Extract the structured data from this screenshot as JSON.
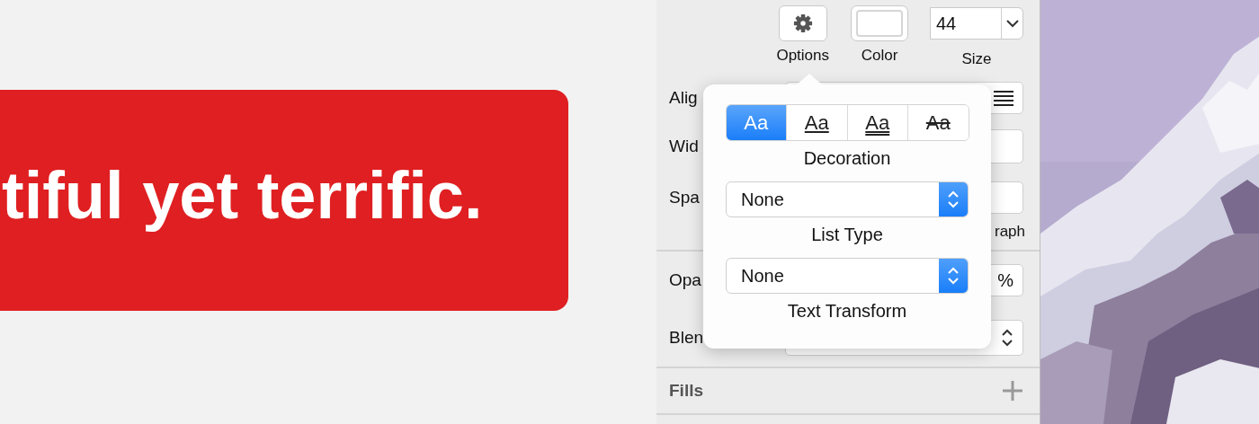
{
  "canvas": {
    "banner_text": "tiful yet terrific."
  },
  "inspector": {
    "text_options": [
      {
        "label": "Options",
        "kind": "gear"
      },
      {
        "label": "Color",
        "kind": "color"
      },
      {
        "label": "Size",
        "kind": "size",
        "value": "44"
      }
    ],
    "rows": [
      {
        "label": "Alig",
        "kind": "alignment"
      },
      {
        "label": "Wid",
        "kind": "width"
      },
      {
        "label": "Spa",
        "kind": "spacing",
        "sublabel": "raph"
      },
      {
        "label": "Opa",
        "kind": "opacity",
        "value": "%"
      },
      {
        "label": "Blen",
        "kind": "blending"
      }
    ],
    "fills": {
      "title": "Fills"
    }
  },
  "popover": {
    "decoration": {
      "label": "Decoration",
      "options": [
        {
          "sample": "Aa",
          "kind": "none",
          "selected": true
        },
        {
          "sample": "Aa",
          "kind": "underline",
          "selected": false
        },
        {
          "sample": "Aa",
          "kind": "double-underline",
          "selected": false
        },
        {
          "sample": "Aa",
          "kind": "strikethrough",
          "selected": false
        }
      ]
    },
    "list_type": {
      "label": "List Type",
      "value": "None"
    },
    "text_transform": {
      "label": "Text Transform",
      "value": "None"
    }
  }
}
